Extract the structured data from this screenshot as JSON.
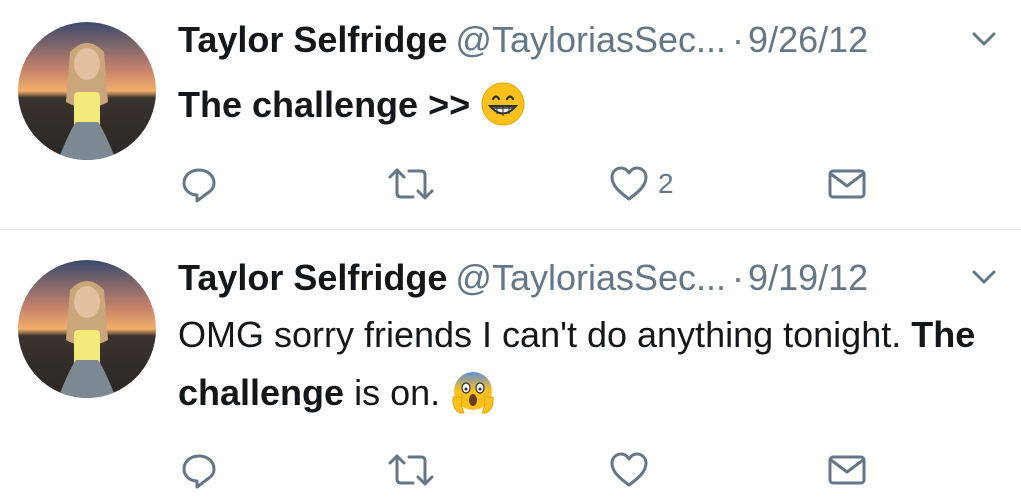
{
  "tweets": [
    {
      "author_name": "Taylor Selfridge",
      "handle": "@TayloriasSec...",
      "separator": "·",
      "date": "9/26/12",
      "text_parts": [
        {
          "text": "The challenge >>",
          "bold": true
        }
      ],
      "emoji": "grinning-face-emoji",
      "reply_count": "",
      "retweet_count": "",
      "like_count": "2"
    },
    {
      "author_name": "Taylor Selfridge",
      "handle": "@TayloriasSec...",
      "separator": "·",
      "date": "9/19/12",
      "text_parts": [
        {
          "text": "OMG sorry friends I can't do anything tonight. ",
          "bold": false
        },
        {
          "text": "The challenge",
          "bold": true
        },
        {
          "text": " is on.",
          "bold": false
        }
      ],
      "emoji": "screaming-face-emoji",
      "reply_count": "",
      "retweet_count": "",
      "like_count": ""
    }
  ],
  "icons": {
    "reply": "reply-icon",
    "retweet": "retweet-icon",
    "like": "heart-icon",
    "dm": "envelope-icon",
    "more": "chevron-down-icon"
  },
  "colors": {
    "text": "#14171a",
    "secondary": "#657786",
    "divider": "#e1e8ed"
  }
}
